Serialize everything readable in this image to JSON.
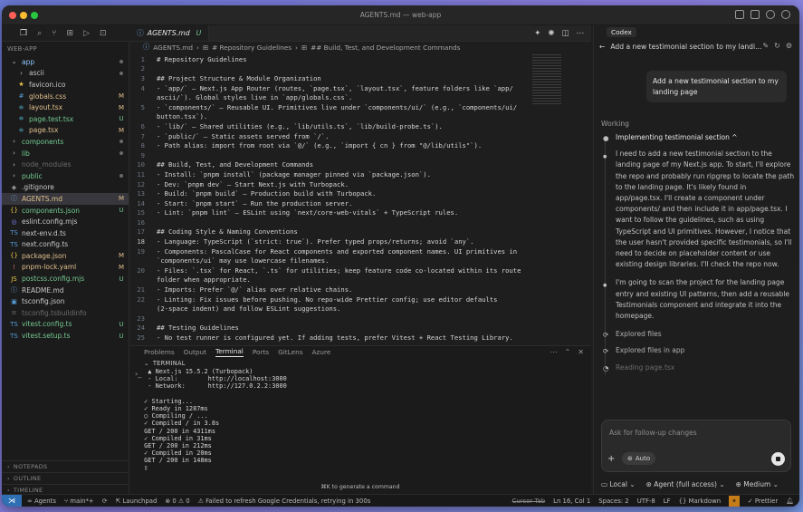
{
  "window": {
    "title": "AGENTS.md — web-app"
  },
  "explorer": {
    "root": "WEB-APP",
    "items": [
      {
        "indent": 0,
        "icon": "chevron-down-icon",
        "glyph": "⌄",
        "color": "#c8c8c8",
        "name": "app",
        "status": "dot",
        "name_color": "#8fc8ff"
      },
      {
        "indent": 1,
        "icon": "chevron-right-icon",
        "glyph": "›",
        "color": "#c8c8c8",
        "name": "ascii",
        "status": "dot",
        "name_color": "#c8c8c8"
      },
      {
        "indent": 1,
        "icon": "star-icon",
        "glyph": "★",
        "color": "#e8c547",
        "name": "favicon.ico",
        "status": "",
        "name_color": "#c8c8c8"
      },
      {
        "indent": 1,
        "icon": "hash-icon",
        "glyph": "#",
        "color": "#569cd6",
        "name": "globals.css",
        "status": "M",
        "name_color": "#e2c08d"
      },
      {
        "indent": 1,
        "icon": "react-icon",
        "glyph": "⚛",
        "color": "#61dafb",
        "name": "layout.tsx",
        "status": "M",
        "name_color": "#e2c08d"
      },
      {
        "indent": 1,
        "icon": "react-icon",
        "glyph": "⚛",
        "color": "#61dafb",
        "name": "page.test.tsx",
        "status": "U",
        "name_color": "#73c991"
      },
      {
        "indent": 1,
        "icon": "react-icon",
        "glyph": "⚛",
        "color": "#61dafb",
        "name": "page.tsx",
        "status": "M",
        "name_color": "#e2c08d"
      },
      {
        "indent": 0,
        "icon": "chevron-right-icon",
        "glyph": "›",
        "color": "#c8c8c8",
        "name": "components",
        "status": "dot",
        "name_color": "#73c991"
      },
      {
        "indent": 0,
        "icon": "chevron-right-icon",
        "glyph": "›",
        "color": "#c8c8c8",
        "name": "lib",
        "status": "dot",
        "name_color": "#73c991"
      },
      {
        "indent": 0,
        "icon": "chevron-right-icon",
        "glyph": "›",
        "color": "#c8c8c8",
        "name": "node_modules",
        "status": "",
        "name_color": "#6b6b6b"
      },
      {
        "indent": 0,
        "icon": "chevron-right-icon",
        "glyph": "›",
        "color": "#c8c8c8",
        "name": "public",
        "status": "dot",
        "name_color": "#73c991"
      },
      {
        "indent": 0,
        "icon": "git-icon",
        "glyph": "◆",
        "color": "#8a8a8a",
        "name": ".gitignore",
        "status": "",
        "name_color": "#c8c8c8"
      },
      {
        "indent": 0,
        "icon": "info-icon",
        "glyph": "ⓘ",
        "color": "#6fa8dc",
        "name": "AGENTS.md",
        "status": "M",
        "name_color": "#e2c08d",
        "selected": true
      },
      {
        "indent": 0,
        "icon": "braces-icon",
        "glyph": "{}",
        "color": "#e8c547",
        "name": "components.json",
        "status": "U",
        "name_color": "#73c991"
      },
      {
        "indent": 0,
        "icon": "eslint-icon",
        "glyph": "◎",
        "color": "#8080f0",
        "name": "eslint.config.mjs",
        "status": "",
        "name_color": "#c8c8c8"
      },
      {
        "indent": 0,
        "icon": "ts-icon",
        "glyph": "TS",
        "color": "#569cd6",
        "name": "next-env.d.ts",
        "status": "",
        "name_color": "#c8c8c8"
      },
      {
        "indent": 0,
        "icon": "ts-icon",
        "glyph": "TS",
        "color": "#569cd6",
        "name": "next.config.ts",
        "status": "",
        "name_color": "#c8c8c8"
      },
      {
        "indent": 0,
        "icon": "braces-icon",
        "glyph": "{}",
        "color": "#e8c547",
        "name": "package.json",
        "status": "M",
        "name_color": "#e2c08d"
      },
      {
        "indent": 0,
        "icon": "yaml-icon",
        "glyph": "!",
        "color": "#e06c75",
        "name": "pnpm-lock.yaml",
        "status": "M",
        "name_color": "#e2c08d"
      },
      {
        "indent": 0,
        "icon": "js-icon",
        "glyph": "JS",
        "color": "#e8c547",
        "name": "postcss.config.mjs",
        "status": "U",
        "name_color": "#73c991"
      },
      {
        "indent": 0,
        "icon": "info-icon",
        "glyph": "ⓘ",
        "color": "#6fa8dc",
        "name": "README.md",
        "status": "",
        "name_color": "#c8c8c8"
      },
      {
        "indent": 0,
        "icon": "tsconfig-icon",
        "glyph": "▣",
        "color": "#569cd6",
        "name": "tsconfig.json",
        "status": "",
        "name_color": "#c8c8c8"
      },
      {
        "indent": 0,
        "icon": "file-icon",
        "glyph": "≡",
        "color": "#6b6b6b",
        "name": "tsconfig.tsbuildinfo",
        "status": "",
        "name_color": "#6b6b6b"
      },
      {
        "indent": 0,
        "icon": "ts-icon",
        "glyph": "TS",
        "color": "#569cd6",
        "name": "vitest.config.ts",
        "status": "U",
        "name_color": "#73c991"
      },
      {
        "indent": 0,
        "icon": "ts-icon",
        "glyph": "TS",
        "color": "#569cd6",
        "name": "vitest.setup.ts",
        "status": "U",
        "name_color": "#73c991"
      }
    ],
    "sections": [
      "NOTEPADS",
      "OUTLINE",
      "TIMELINE"
    ]
  },
  "editor": {
    "tab": {
      "name": "AGENTS.md",
      "status": "U"
    },
    "breadcrumb": [
      "AGENTS.md",
      "# Repository Guidelines",
      "## Build, Test, and Development Commands"
    ],
    "current_line": 18,
    "lines": [
      {
        "n": "1",
        "t": "# Repository Guidelines"
      },
      {
        "n": "2",
        "t": ""
      },
      {
        "n": "3",
        "t": "## Project Structure & Module Organization"
      },
      {
        "n": "4",
        "t": "- `app/` — Next.js App Router (routes, `page.tsx`, `layout.tsx`, feature folders like `app/"
      },
      {
        "n": "",
        "t": "ascii/`). Global styles live in `app/globals.css`."
      },
      {
        "n": "5",
        "t": "- `components/` — Reusable UI. Primitives live under `components/ui/` (e.g., `components/ui/"
      },
      {
        "n": "",
        "t": "button.tsx`)."
      },
      {
        "n": "6",
        "t": "- `lib/` — Shared utilities (e.g., `lib/utils.ts`, `lib/build-probe.ts`)."
      },
      {
        "n": "7",
        "t": "- `public/` — Static assets served from `/`."
      },
      {
        "n": "8",
        "t": "- Path alias: import from root via `@/` (e.g., `import { cn } from \"@/lib/utils\"`)."
      },
      {
        "n": "9",
        "t": ""
      },
      {
        "n": "10",
        "t": "## Build, Test, and Development Commands"
      },
      {
        "n": "11",
        "t": "- Install: `pnpm install` (package manager pinned via `package.json`)."
      },
      {
        "n": "12",
        "t": "- Dev: `pnpm dev` — Start Next.js with Turbopack."
      },
      {
        "n": "13",
        "t": "- Build: `pnpm build` — Production build with Turbopack."
      },
      {
        "n": "14",
        "t": "- Start: `pnpm start` — Run the production server."
      },
      {
        "n": "15",
        "t": "- Lint: `pnpm lint` — ESLint using `next/core-web-vitals` + TypeScript rules."
      },
      {
        "n": "16",
        "t": ""
      },
      {
        "n": "17",
        "t": "## Coding Style & Naming Conventions"
      },
      {
        "n": "18",
        "t": "- Language: TypeScript (`strict: true`). Prefer typed props/returns; avoid `any`."
      },
      {
        "n": "19",
        "t": "- Components: PascalCase for React components and exported component names. UI primitives in"
      },
      {
        "n": "",
        "t": "`components/ui` may use lowercase filenames."
      },
      {
        "n": "20",
        "t": "- Files: `.tsx` for React, `.ts` for utilities; keep feature code co-located within its route"
      },
      {
        "n": "",
        "t": "folder when appropriate."
      },
      {
        "n": "21",
        "t": "- Imports: Prefer `@/` alias over relative chains."
      },
      {
        "n": "22",
        "t": "- Linting: Fix issues before pushing. No repo-wide Prettier config; use editor defaults"
      },
      {
        "n": "",
        "t": "(2-space indent) and follow ESLint suggestions."
      },
      {
        "n": "23",
        "t": ""
      },
      {
        "n": "24",
        "t": "## Testing Guidelines"
      },
      {
        "n": "25",
        "t": "- No test runner is configured yet. If adding tests, prefer Vitest + React Testing Library."
      }
    ]
  },
  "panel": {
    "tabs": [
      "Problems",
      "Output",
      "Terminal",
      "Ports",
      "GitLens",
      "Azure"
    ],
    "active_tab": "Terminal",
    "terminal_label": "TERMINAL",
    "lines": [
      {
        "t": "  ▲ Next.js 15.5.2 (Turbopack)",
        "c": "#d4d4d4"
      },
      {
        "t": "  - Local:        http://localhost:3000",
        "c": "#d4d4d4"
      },
      {
        "t": "  - Network:      http://127.0.2.2:3000",
        "c": "#d4d4d4"
      },
      {
        "t": "",
        "c": "#d4d4d4"
      },
      {
        "t": " ✓ Starting...",
        "c": "#d4d4d4"
      },
      {
        "t": " ✓ Ready in 1287ms",
        "c": "#d4d4d4"
      },
      {
        "t": " ○ Compiling / ...",
        "c": "#d4d4d4"
      },
      {
        "t": " ✓ Compiled / in 3.8s",
        "c": "#d4d4d4"
      },
      {
        "t": " GET / 200 in 4311ms",
        "c": "#d4d4d4"
      },
      {
        "t": " ✓ Compiled in 31ms",
        "c": "#d4d4d4"
      },
      {
        "t": " GET / 200 in 212ms",
        "c": "#d4d4d4"
      },
      {
        "t": " ✓ Compiled in 20ms",
        "c": "#d4d4d4"
      },
      {
        "t": " GET / 200 in 148ms",
        "c": "#d4d4d4"
      },
      {
        "t": " ▯",
        "c": "#d4d4d4"
      }
    ],
    "generate_hint": "⌘K to generate a command"
  },
  "codex": {
    "tab": "Codex",
    "thread_title": "Add a new testimonial section to my landi...",
    "user_message": "Add a new testimonial section to my landing page",
    "working": "Working",
    "steps": [
      {
        "kind": "title",
        "text": "Implementing testimonial section ^"
      },
      {
        "kind": "body",
        "text": "I need to add a new testimonial section to the landing page of my Next.js app. To start, I'll explore the repo and probably run ripgrep to locate the path to the landing page. It's likely found in app/page.tsx. I'll create a component under components/ and then include it in app/page.tsx. I want to follow the guidelines, such as using TypeScript and UI primitives. However, I notice that the user hasn't provided specific testimonials, so I'll need to decide on placeholder content or use existing design libraries. I'll check the repo now."
      },
      {
        "kind": "body",
        "text": "I'm going to scan the project for the landing page entry and existing UI patterns, then add a reusable Testimonials component and integrate it into the homepage."
      },
      {
        "kind": "action",
        "text": "Explored files"
      },
      {
        "kind": "action",
        "text": "Explored files in app"
      },
      {
        "kind": "dim",
        "text": "Reading page.tsx"
      }
    ],
    "composer_placeholder": "Ask for follow-up changes",
    "auto_label": "Auto",
    "footer": [
      "Local",
      "Agent (full access)",
      "Medium"
    ]
  },
  "statusbar": {
    "left": [
      "Agents",
      "main*+",
      "Launchpad",
      "⊗ 0 ⚠ 0",
      "Failed to refresh Google Credentials, retrying in 300s"
    ],
    "right": [
      "Cursor Tab",
      "Ln 16, Col 1",
      "Spaces: 2",
      "UTF-8",
      "LF",
      "{} Markdown",
      "Prettier"
    ]
  },
  "colors": {
    "accent": "#2f6fb3",
    "modified": "#e2c08d",
    "untracked": "#73c991",
    "warning": "#c77d17"
  }
}
